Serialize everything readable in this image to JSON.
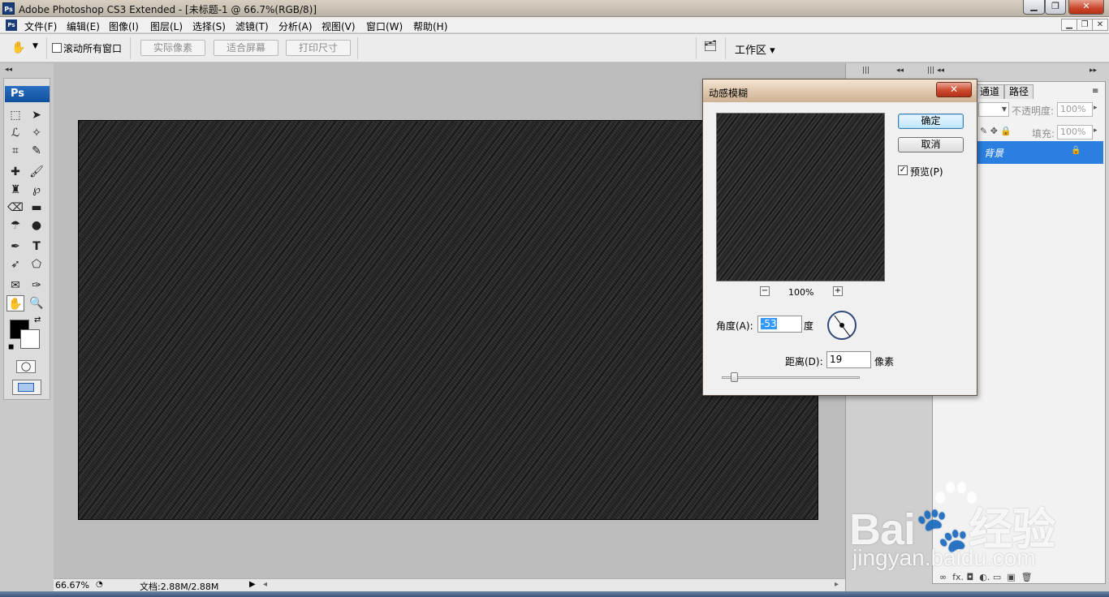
{
  "window": {
    "title": "Adobe Photoshop CS3 Extended - [未标题-1 @ 66.7%(RGB/8)]",
    "app_badge": "Ps"
  },
  "menu": [
    "文件(F)",
    "编辑(E)",
    "图像(I)",
    "图层(L)",
    "选择(S)",
    "滤镜(T)",
    "分析(A)",
    "视图(V)",
    "窗口(W)",
    "帮助(H)"
  ],
  "options": {
    "scroll_all_label": "滚动所有窗口",
    "buttons": [
      "实际像素",
      "适合屏幕",
      "打印尺寸"
    ],
    "workspace_label": "工作区 ▾"
  },
  "toolbox": {
    "logo": "Ps"
  },
  "statusbar": {
    "zoom": "66.67%",
    "doc_info": "文档:2.88M/2.88M"
  },
  "layers_panel": {
    "tabs": [
      "通道",
      "路径"
    ],
    "opacity_label": "不透明度:",
    "opacity_value": "100%",
    "fill_label": "填充:",
    "fill_value": "100%",
    "layer_name": "背景"
  },
  "dialog": {
    "title": "动感模糊",
    "ok_label": "确定",
    "cancel_label": "取消",
    "preview_label": "预览(P)",
    "preview_checked": true,
    "zoom_level": "100%",
    "angle_label": "角度(A):",
    "angle_value": "-53",
    "angle_unit": "度",
    "distance_label": "距离(D):",
    "distance_value": "19",
    "distance_unit": "像素"
  },
  "watermark": {
    "main": "Bai🐾经验",
    "sub": "jingyan.baidu.com"
  },
  "colors": {
    "accent": "#2b7fe1",
    "canvas": "#232323",
    "dialog_title": "#dfc7ad"
  }
}
